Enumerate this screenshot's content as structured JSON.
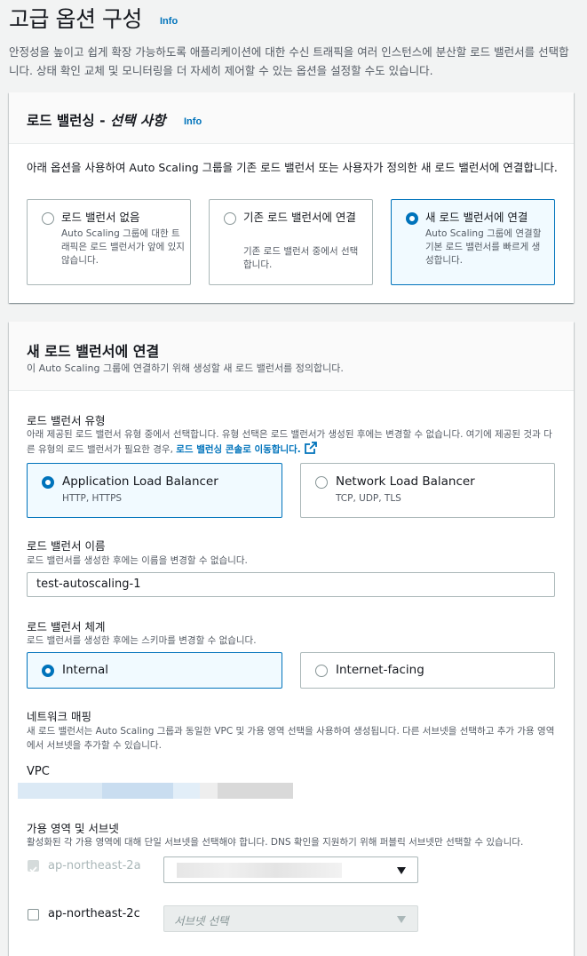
{
  "page": {
    "title": "고급 옵션 구성",
    "info": "Info",
    "description": "안정성을 높이고 쉽게 확장 가능하도록 애플리케이션에 대한 수신 트래픽을 여러 인스턴스에 분산할 로드 밸런서를 선택합니다. 상태 확인 교체 및 모니터링을 더 자세히 제어할 수 있는 옵션을 설정할 수도 있습니다."
  },
  "load_balancing": {
    "title": "로드 밸런싱 - ",
    "title_italic": "선택 사항",
    "info": "Info",
    "description": "아래 옵션을 사용하여 Auto Scaling 그룹을 기존 로드 밸런서 또는 사용자가 정의한 새 로드 밸런서에 연결합니다.",
    "options": [
      {
        "label": "로드 밸런서 없음",
        "desc": "Auto Scaling 그룹에 대한 트래픽은 로드 밸런서가 앞에 있지 않습니다.",
        "selected": false
      },
      {
        "label": "기존 로드 밸런서에 연결",
        "desc": "기존 로드 밸런서 중에서 선택합니다.",
        "selected": false
      },
      {
        "label": "새 로드 밸런서에 연결",
        "desc": "Auto Scaling 그룹에 연결할 기본 로드 밸런서를 빠르게 생성합니다.",
        "selected": true
      }
    ]
  },
  "new_lb": {
    "title": "새 로드 밸런서에 연결",
    "description": "이 Auto Scaling 그룹에 연결하기 위해 생성할 새 로드 밸런서를 정의합니다.",
    "type": {
      "label": "로드 밸런서 유형",
      "desc": "아래 제공된 로드 밸런서 유형 중에서 선택합니다. 유형 선택은 로드 밸런서가 생성된 후에는 변경할 수 없습니다. 여기에 제공된 것과 다른 유형의 로드 밸런서가 필요한 경우, ",
      "link": "로드 밸런싱 콘솔로 이동합니다.",
      "options": [
        {
          "label": "Application Load Balancer",
          "sub": "HTTP, HTTPS",
          "selected": true
        },
        {
          "label": "Network Load Balancer",
          "sub": "TCP, UDP, TLS",
          "selected": false
        }
      ]
    },
    "name": {
      "label": "로드 밸런서 이름",
      "desc": "로드 밸런서를 생성한 후에는 이름을 변경할 수 없습니다.",
      "value": "test-autoscaling-1"
    },
    "scheme": {
      "label": "로드 밸런서 체계",
      "desc": "로드 밸런서를 생성한 후에는 스키마를 변경할 수 없습니다.",
      "options": [
        {
          "label": "Internal",
          "selected": true
        },
        {
          "label": "Internet-facing",
          "selected": false
        }
      ]
    },
    "network": {
      "label": "네트워크 매핑",
      "desc": "새 로드 밸런서는 Auto Scaling 그룹과 동일한 VPC 및 가용 영역 선택을 사용하여 생성됩니다. 다른 서브넷을 선택하고 추가 가용 영역에서 서브넷을 추가할 수 있습니다."
    },
    "vpc": {
      "label": "VPC"
    },
    "az": {
      "label": "가용 영역 및 서브넷",
      "desc": "활성화된 각 가용 영역에 대해 단일 서브넷을 선택해야 합니다. DNS 확인을 지원하기 위해 퍼블릭 서브넷만 선택할 수 있습니다.",
      "zones": [
        {
          "name": "ap-northeast-2a",
          "checked": true,
          "disabled": true
        },
        {
          "name": "ap-northeast-2c",
          "checked": false,
          "placeholder": "서브넷 선택"
        }
      ]
    }
  },
  "colors": {
    "accent": "#0073bb",
    "selected_bg": "#f1faff",
    "border": "#aab7b8"
  }
}
